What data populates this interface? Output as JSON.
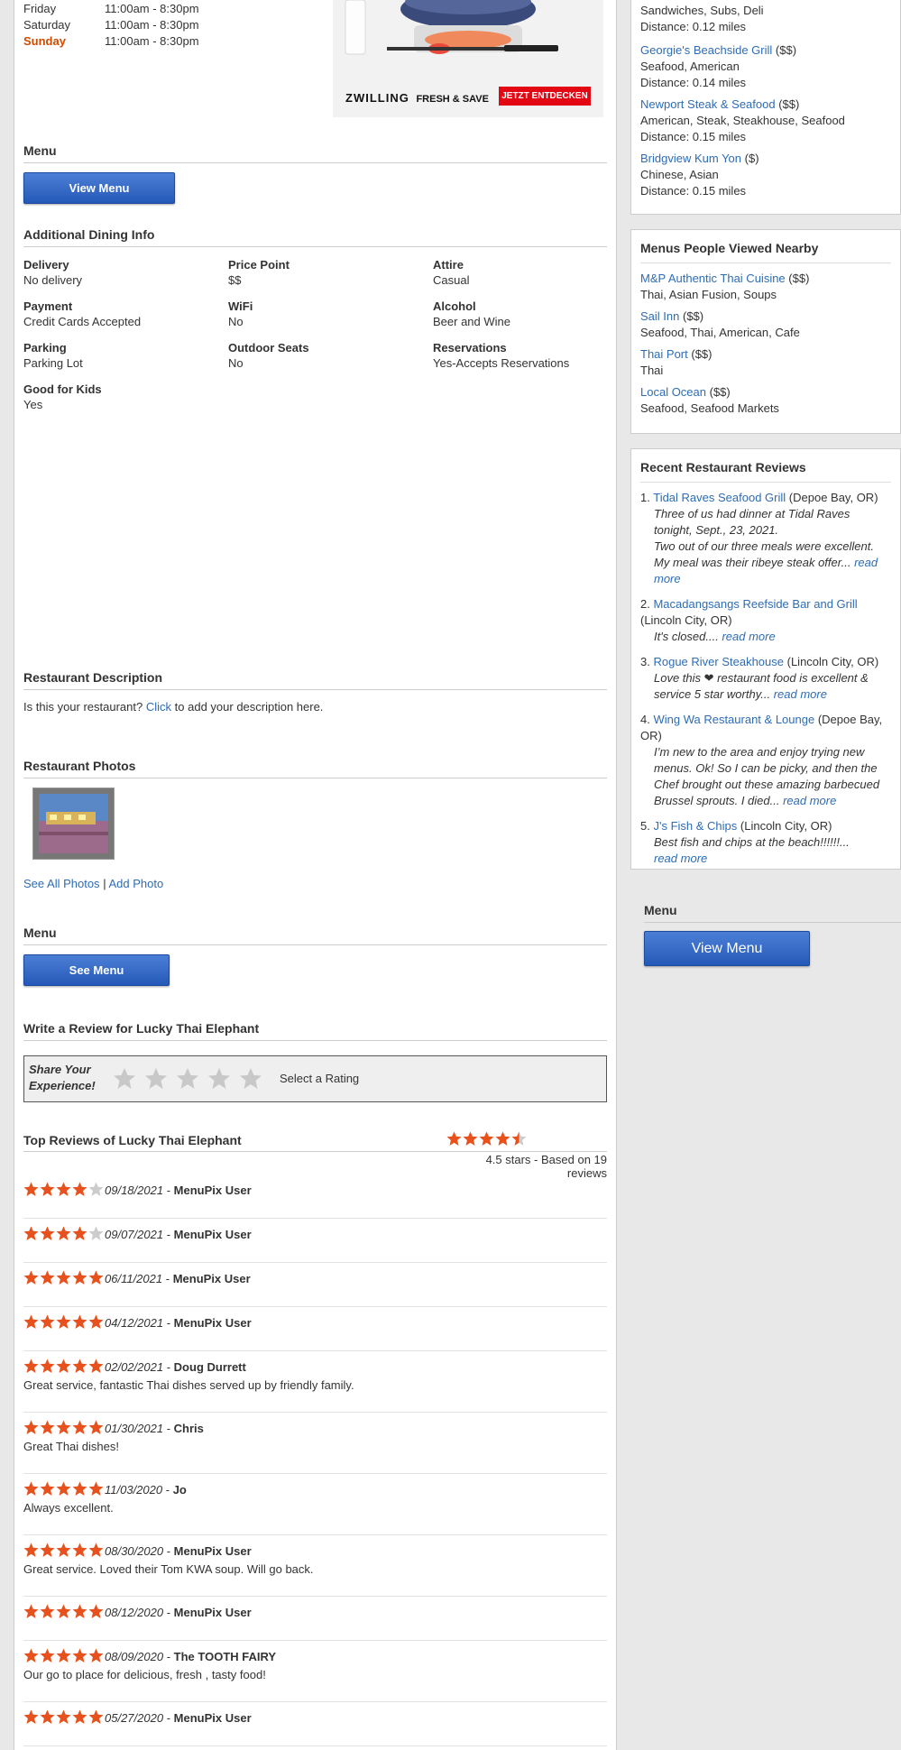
{
  "hours": [
    {
      "day": "Friday",
      "time": "11:00am - 8:30pm",
      "today": false
    },
    {
      "day": "Saturday",
      "time": "11:00am - 8:30pm",
      "today": false
    },
    {
      "day": "Sunday",
      "time": "11:00am - 8:30pm",
      "today": true
    }
  ],
  "ad": {
    "brand": "ZWILLING",
    "tagline": "FRESH & SAVE",
    "cta": "JETZT ENTDECKEN"
  },
  "menu_section": {
    "title": "Menu",
    "button": "View Menu"
  },
  "dining": {
    "title": "Additional Dining Info",
    "items": [
      {
        "label": "Delivery",
        "value": "No delivery"
      },
      {
        "label": "Price Point",
        "value": "$$"
      },
      {
        "label": "Attire",
        "value": "Casual"
      },
      {
        "label": "Payment",
        "value": "Credit Cards Accepted"
      },
      {
        "label": "WiFi",
        "value": "No"
      },
      {
        "label": "Alcohol",
        "value": "Beer and Wine"
      },
      {
        "label": "Parking",
        "value": "Parking Lot"
      },
      {
        "label": "Outdoor Seats",
        "value": "No"
      },
      {
        "label": "Reservations",
        "value": "Yes-Accepts Reservations"
      },
      {
        "label": "Good for Kids",
        "value": "Yes"
      }
    ]
  },
  "description": {
    "title": "Restaurant Description",
    "pre": "Is this your restaurant?",
    "link": "Click",
    "post": "to add your description here."
  },
  "photos": {
    "title": "Restaurant Photos",
    "see_all": "See All Photos",
    "sep": "|",
    "add": "Add Photo"
  },
  "menu2": {
    "title": "Menu",
    "button": "See Menu"
  },
  "write_review": {
    "title": "Write a Review for Lucky Thai Elephant",
    "prompt_line1": "Share Your",
    "prompt_line2": "Experience!",
    "select_label": "Select a Rating"
  },
  "top_reviews": {
    "title": "Top Reviews of Lucky Thai Elephant",
    "rating": 4.5,
    "summary": "4.5 stars - Based on 19 reviews",
    "reviews": [
      {
        "stars": 4,
        "date": "09/18/2021",
        "sep": "-",
        "author": "MenuPix User",
        "text": ""
      },
      {
        "stars": 4,
        "date": "09/07/2021",
        "sep": "-",
        "author": "MenuPix User",
        "text": ""
      },
      {
        "stars": 5,
        "date": "06/11/2021",
        "sep": "-",
        "author": "MenuPix User",
        "text": ""
      },
      {
        "stars": 5,
        "date": "04/12/2021",
        "sep": "-",
        "author": "MenuPix User",
        "text": ""
      },
      {
        "stars": 5,
        "date": "02/02/2021",
        "sep": "-",
        "author": "Doug Durrett",
        "text": "Great service, fantastic Thai dishes served up by friendly family."
      },
      {
        "stars": 5,
        "date": "01/30/2021",
        "sep": "-",
        "author": "Chris",
        "text": "Great Thai dishes!"
      },
      {
        "stars": 5,
        "date": "11/03/2020",
        "sep": "-",
        "author": "Jo",
        "text": "Always excellent."
      },
      {
        "stars": 5,
        "date": "08/30/2020",
        "sep": "-",
        "author": "MenuPix User",
        "text": "Great service. Loved their Tom KWA soup. Will go back."
      },
      {
        "stars": 5,
        "date": "08/12/2020",
        "sep": "-",
        "author": "MenuPix User",
        "text": ""
      },
      {
        "stars": 5,
        "date": "08/09/2020",
        "sep": "-",
        "author": "The TOOTH FAIRY",
        "text": "Our go to place for delicious, fresh , tasty food!"
      },
      {
        "stars": 5,
        "date": "05/27/2020",
        "sep": "-",
        "author": "MenuPix User",
        "text": ""
      }
    ]
  },
  "nearby": {
    "top_partial": "Sandwiches, Subs, Deli",
    "top_distance": "Distance: 0.12 miles",
    "items": [
      {
        "name": "Georgie's Beachside Grill",
        "price": "($$)",
        "cuisine": "Seafood, American",
        "distance": "Distance: 0.14 miles"
      },
      {
        "name": "Newport Steak & Seafood",
        "price": "($$)",
        "cuisine": "American, Steak, Steakhouse, Seafood",
        "distance": "Distance: 0.15 miles"
      },
      {
        "name": "Bridgview Kum Yon",
        "price": "($)",
        "cuisine": "Chinese, Asian",
        "distance": "Distance: 0.15 miles"
      }
    ]
  },
  "viewed": {
    "title": "Menus People Viewed Nearby",
    "items": [
      {
        "name": "M&P Authentic Thai Cuisine",
        "price": "($$)",
        "cuisine": "Thai, Asian Fusion, Soups"
      },
      {
        "name": "Sail Inn",
        "price": "($$)",
        "cuisine": "Seafood, Thai, American, Cafe"
      },
      {
        "name": "Thai Port",
        "price": "($$)",
        "cuisine": "Thai"
      },
      {
        "name": "Local Ocean",
        "price": "($$)",
        "cuisine": "Seafood, Seafood Markets"
      }
    ]
  },
  "recent": {
    "title": "Recent Restaurant Reviews",
    "read_more": "read more",
    "items": [
      {
        "num": "1.",
        "name": "Tidal Raves Seafood Grill",
        "loc": "(Depoe Bay, OR)",
        "quote": "Three of us had dinner at Tidal Raves tonight, Sept., 23, 2021.",
        "quote2": "Two out of our three meals were excellent. My meal was their ribeye steak offer..."
      },
      {
        "num": "2.",
        "name": "Macadangsangs Reefside Bar and Grill",
        "loc": "(Lincoln City, OR)",
        "quote": "It's closed....",
        "quote2": ""
      },
      {
        "num": "3.",
        "name": "Rogue River Steakhouse",
        "loc": "(Lincoln City, OR)",
        "quote": "Love this ❤ restaurant food is excellent & service 5 star worthy...",
        "quote2": ""
      },
      {
        "num": "4.",
        "name": "Wing Wa Restaurant & Lounge",
        "loc": "(Depoe Bay, OR)",
        "quote": "I’m new to the area and enjoy trying new menus. Ok! So I can be picky, and then the Chef brought out these amazing barbecued Brussel sprouts. I died...",
        "quote2": ""
      },
      {
        "num": "5.",
        "name": "J's Fish & Chips",
        "loc": "(Lincoln City, OR)",
        "quote": "Best fish and chips at the beach!!!!!!...",
        "quote2": ""
      }
    ]
  },
  "sidebar_menu": {
    "title": "Menu",
    "button": "View Menu"
  },
  "colors": {
    "accent": "#2e6cb5",
    "today": "#d04a00",
    "star": "#e8501c"
  }
}
